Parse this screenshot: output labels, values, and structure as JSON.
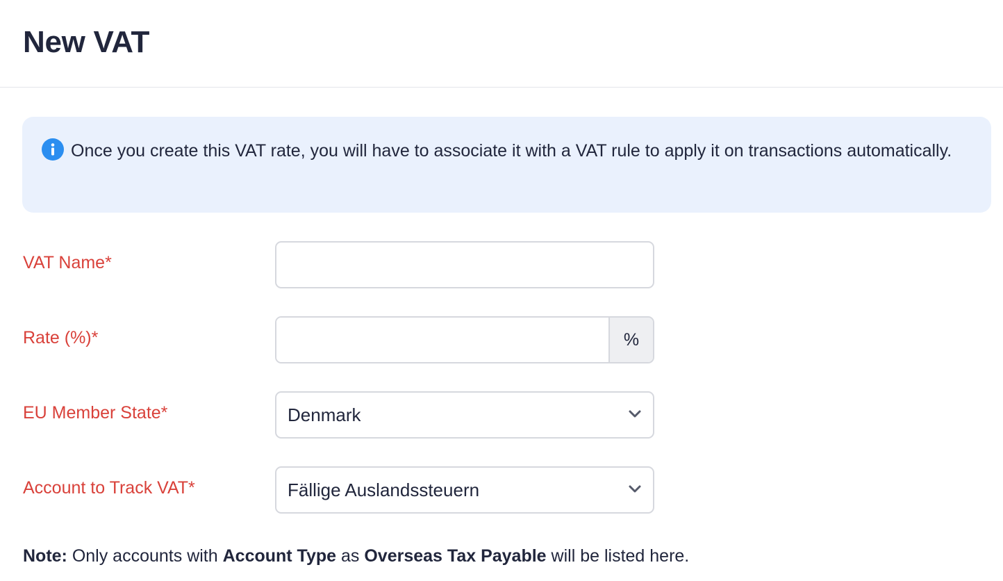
{
  "page": {
    "title": "New VAT"
  },
  "info_banner": {
    "icon": "info-icon",
    "text": "Once you create this VAT rate, you will have to associate it with a VAT rule to apply it on transactions automatically."
  },
  "form": {
    "vat_name": {
      "label": "VAT Name*",
      "value": "",
      "placeholder": ""
    },
    "rate": {
      "label": "Rate (%)*",
      "value": "",
      "placeholder": "",
      "suffix": "%"
    },
    "eu_member_state": {
      "label": "EU Member State*",
      "selected": "Denmark"
    },
    "account_to_track": {
      "label": "Account to Track VAT*",
      "selected": "Fällige Auslandssteuern"
    }
  },
  "note": {
    "prefix": "Note:",
    "text1": " Only accounts with ",
    "account_type": "Account Type",
    "text2": " as ",
    "overseas": "Overseas Tax Payable",
    "text3": " will be listed here."
  },
  "colors": {
    "required_label": "#d9413a",
    "banner_bg": "#eaf1fd",
    "info_icon": "#2b8ef0",
    "text": "#21263c"
  }
}
